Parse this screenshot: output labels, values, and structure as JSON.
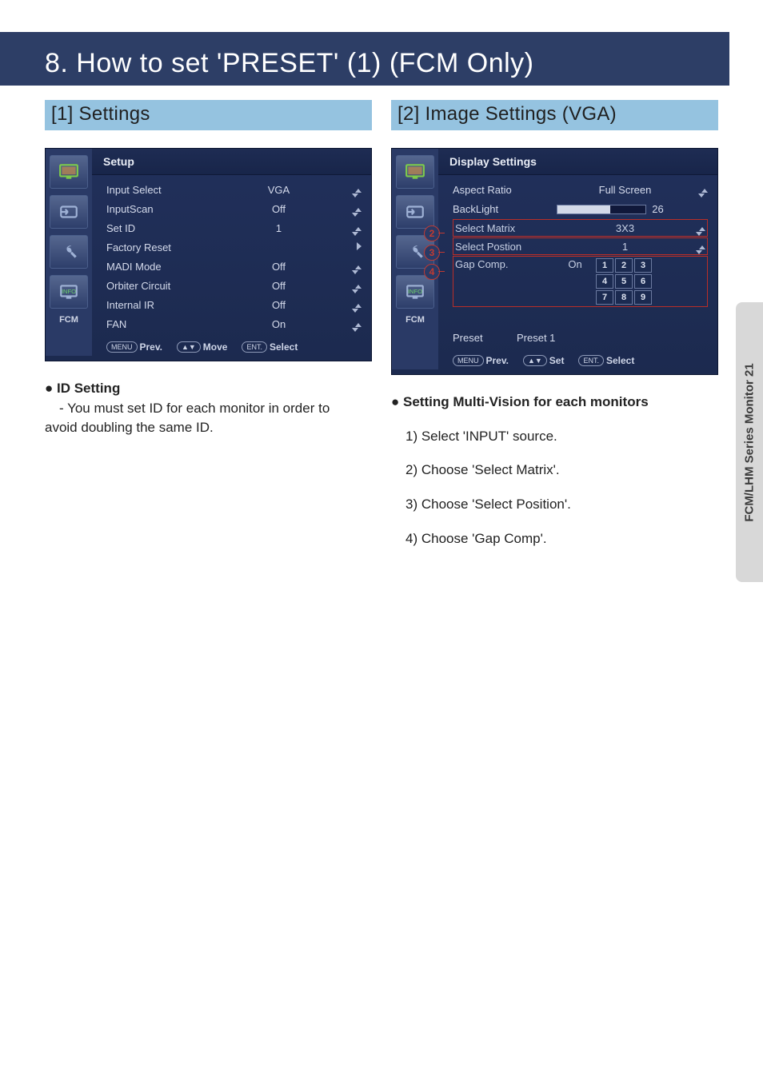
{
  "banner": "8. How to set 'PRESET' (1) (FCM Only)",
  "sideTab": "FCM/LHM Series Monitor 21",
  "left": {
    "heading": "[1] Settings",
    "osd": {
      "title": "Setup",
      "fcm": "FCM",
      "rows": [
        {
          "label": "Input Select",
          "value": "VGA",
          "arrow": "ud"
        },
        {
          "label": "InputScan",
          "value": "Off",
          "arrow": "ud"
        },
        {
          "label": "Set ID",
          "value": "1",
          "arrow": "ud"
        },
        {
          "label": "Factory Reset",
          "value": "",
          "arrow": "r"
        },
        {
          "label": "MADI Mode",
          "value": "Off",
          "arrow": "ud"
        },
        {
          "label": "Orbiter Circuit",
          "value": "Off",
          "arrow": "ud"
        },
        {
          "label": "Internal IR",
          "value": "Off",
          "arrow": "ud"
        },
        {
          "label": "FAN",
          "value": "On",
          "arrow": "ud"
        }
      ],
      "foot": {
        "k1": "MENU",
        "t1": "Prev.",
        "k2": "▲▼",
        "t2": "Move",
        "k3": "ENT.",
        "t3": "Select"
      }
    },
    "note_head": "ID Setting",
    "note_body": "- You must set ID for each  monitor in order to\n   avoid doubling the same ID."
  },
  "right": {
    "heading": "[2] Image Settings (VGA)",
    "osd": {
      "title": "Display Settings",
      "fcm": "FCM",
      "aspect": {
        "label": "Aspect Ratio",
        "value": "Full Screen"
      },
      "backlight": {
        "label": "BackLight",
        "value": "26"
      },
      "matrix": {
        "label": "Select Matrix",
        "value": "3X3",
        "badge": "2"
      },
      "position": {
        "label": "Select Postion",
        "value": "1",
        "badge": "3"
      },
      "gap": {
        "label": "Gap Comp.",
        "value": "On",
        "badge": "4"
      },
      "grid": [
        "1",
        "2",
        "3",
        "4",
        "5",
        "6",
        "7",
        "8",
        "9"
      ],
      "preset": {
        "label": "Preset",
        "value": "Preset 1"
      },
      "foot": {
        "k1": "MENU",
        "t1": "Prev.",
        "k2": "▲▼",
        "t2": "Set",
        "k3": "ENT.",
        "t3": "Select"
      }
    },
    "note_head": "Setting Multi-Vision for each monitors",
    "steps": [
      "1) Select 'INPUT' source.",
      "2) Choose 'Select Matrix'.",
      "3) Choose 'Select Position'.",
      "4) Choose 'Gap Comp'."
    ]
  }
}
